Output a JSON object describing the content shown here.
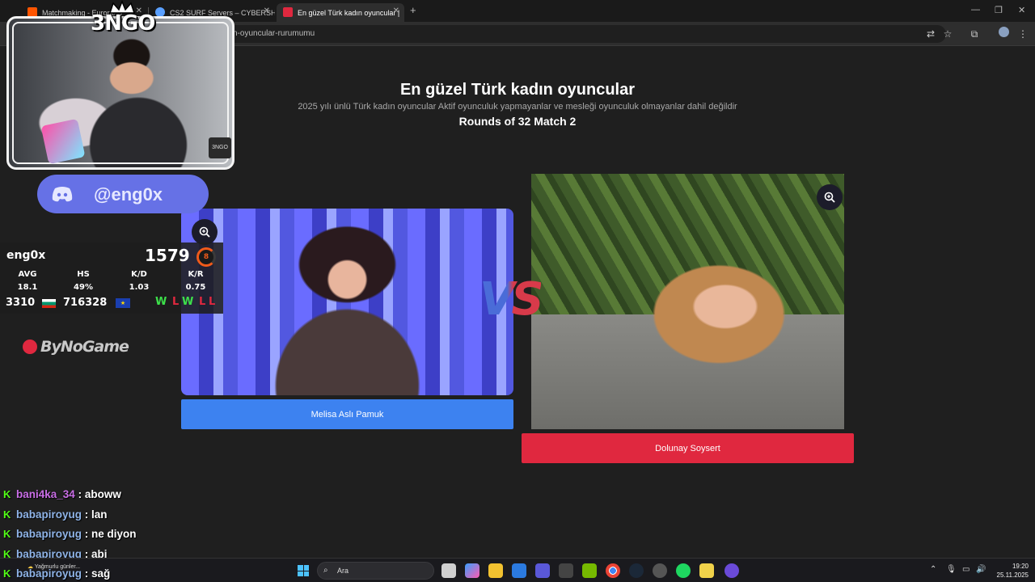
{
  "browser": {
    "tabs": [
      {
        "title": "Matchmaking - Europe S",
        "active": false
      },
      {
        "title": "CS2 SURF Servers – CYBERSHOKE",
        "active": false
      },
      {
        "title": "En güzel Türk kadın oyuncular |",
        "active": true
      }
    ],
    "new_tab_icon": "plus-icon",
    "url": "n-oyuncular-rurumumu"
  },
  "page": {
    "title": "En güzel Türk kadın oyuncular",
    "subtitle": "2025 yılı ünlü Türk kadın oyuncular Aktif oyunculuk yapmayanlar ve mesleği oyunculuk olmayanlar dahil değildir",
    "round_info": "Rounds of 32 Match 2",
    "vs_label": "VS",
    "left_choice": "Melisa Aslı Pamuk",
    "right_choice": "Dolunay Soysert",
    "colors": {
      "left": "#3d82f0",
      "right": "#e0283f"
    }
  },
  "overlay": {
    "brand": "3NGO",
    "cam_badge": "3NGO",
    "discord_handle": "@eng0x",
    "stats": {
      "name": "eng0x",
      "elo": "1579",
      "level": "8",
      "labels": [
        "AVG",
        "HS",
        "K/D",
        "K/R"
      ],
      "values": [
        "18.1",
        "49%",
        "1.03",
        "0.75"
      ],
      "country_rank": "3310",
      "region_rank": "716328",
      "results": [
        "W",
        "L",
        "W",
        "L",
        "L"
      ]
    },
    "sponsor": "ByNoGame",
    "chat": [
      {
        "user": "bani4ka_34",
        "message": ": aboww",
        "color": "purple"
      },
      {
        "user": "babapiroyug",
        "message": ": lan",
        "color": "blue"
      },
      {
        "user": "babapiroyug",
        "message": ": ne diyon",
        "color": "blue"
      },
      {
        "user": "babapiroyug",
        "message": ": abi",
        "color": "blue"
      },
      {
        "user": "babapiroyug",
        "message": ": sağ",
        "color": "blue"
      }
    ]
  },
  "taskbar": {
    "weather": "Yağmurlu günler...",
    "search_placeholder": "Ara",
    "time": "19:20",
    "date": "25.11.2025"
  }
}
